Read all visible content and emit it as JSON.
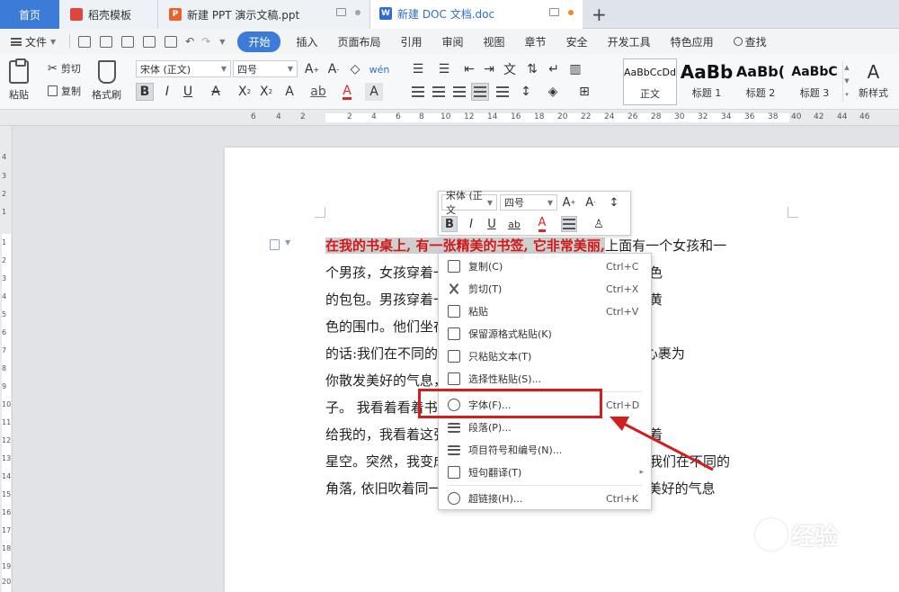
{
  "tabs": {
    "home": "首页",
    "t1": "稻壳模板",
    "t2": "新建 PPT 演示文稿.ppt",
    "t3": "新建 DOC 文档.doc",
    "add": "+"
  },
  "menubar": {
    "file": "文件",
    "items": [
      "开始",
      "插入",
      "页面布局",
      "引用",
      "审阅",
      "视图",
      "章节",
      "安全",
      "开发工具",
      "特色应用"
    ],
    "search": "查找"
  },
  "ribbon": {
    "paste": "粘贴",
    "cut": "剪切",
    "copy": "复制",
    "format_painter": "格式刷",
    "font_name": "宋体 (正文)",
    "font_size": "四号",
    "styles": [
      {
        "sample": "AaBbCcDd",
        "label": "正文"
      },
      {
        "sample": "AaBb",
        "label": "标题 1"
      },
      {
        "sample": "AaBb(",
        "label": "标题 2"
      },
      {
        "sample": "AaBbC",
        "label": "标题 3"
      }
    ],
    "new_style": "新样式"
  },
  "ruler_numbers": [
    "6",
    "4",
    "2",
    "2",
    "4",
    "6",
    "8",
    "10",
    "12",
    "14",
    "16",
    "18",
    "20",
    "22",
    "24",
    "26",
    "28",
    "30",
    "32",
    "34",
    "36",
    "38",
    "40",
    "42",
    "44",
    "46"
  ],
  "vruler_numbers": [
    "4",
    "3",
    "2",
    "1",
    "1",
    "2",
    "3",
    "4",
    "5",
    "6",
    "7",
    "8",
    "9",
    "10",
    "11",
    "12",
    "13",
    "14",
    "15",
    "16",
    "17",
    "18",
    "19",
    "20"
  ],
  "document": {
    "selected": "在我的书桌上, 有一张精美的书签, 它非常美丽,",
    "line1_rest": "上面有一个女孩和一",
    "lines": [
      "个男孩，女孩穿着一件蓝色的裙子，手里还拿着一个橙色",
      "的包包。男孩穿着一件白色的衬衫，脖子上围着一条土黄",
      "色的围巾。他们坐在书签的右下角，星空上有一段很美",
      "的话:我们在不同的角落，吹着同一阵风，暗香浮动,在心裹为",
      "你散发美好的气息，这张书签的名字--糖果屋里的小妮",
      "子。 我看着看着书签，想起这张书签是我的好朋友送",
      "给我的，我看着这张书签上那个蓝色的女孩，静静地望着",
      "星空。突然，我变成了书签里的小女孩，在太空遨游，我们在不同的",
      "角落, 依旧吹着同一阵风, 让暗香浮动, 在心裹为你散发美好的气息"
    ]
  },
  "mini_toolbar": {
    "font": "宋体 (正文",
    "size": "四号"
  },
  "context_menu": [
    {
      "label": "复制(C)",
      "shortcut": "Ctrl+C"
    },
    {
      "label": "剪切(T)",
      "shortcut": "Ctrl+X"
    },
    {
      "label": "粘贴",
      "shortcut": "Ctrl+V"
    },
    {
      "label": "保留源格式粘贴(K)",
      "shortcut": ""
    },
    {
      "label": "只粘贴文本(T)",
      "shortcut": ""
    },
    {
      "label": "选择性粘贴(S)...",
      "shortcut": ""
    },
    {
      "label": "字体(F)...",
      "shortcut": "Ctrl+D"
    },
    {
      "label": "段落(P)...",
      "shortcut": ""
    },
    {
      "label": "项目符号和编号(N)...",
      "shortcut": ""
    },
    {
      "label": "短句翻译(T)",
      "shortcut": ""
    },
    {
      "label": "超链接(H)...",
      "shortcut": "Ctrl+K"
    }
  ],
  "watermark": "经验",
  "colors": {
    "accent": "#3c7bd8",
    "selection_text": "#d01818",
    "annotation": "#d41e1e"
  }
}
